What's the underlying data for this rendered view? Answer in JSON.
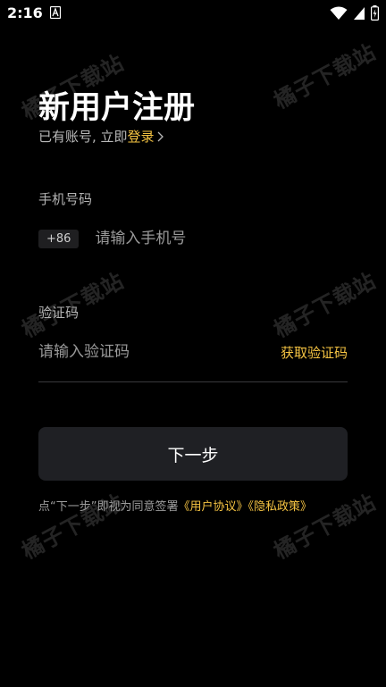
{
  "status_bar": {
    "time": "2:16",
    "icons": [
      "notification-a-icon",
      "wifi-icon",
      "cellular-signal-icon",
      "battery-charging-icon"
    ]
  },
  "watermark": {
    "text": "橘子下载站"
  },
  "header": {
    "title": "新用户注册",
    "subtitle_prefix": "已有账号, 立即",
    "login_link": "登录"
  },
  "phone_field": {
    "label": "手机号码",
    "country_code": "+86",
    "placeholder": "请输入手机号",
    "value": ""
  },
  "code_field": {
    "label": "验证码",
    "placeholder": "请输入验证码",
    "value": "",
    "get_code_label": "获取验证码"
  },
  "next_button": {
    "label": "下一步"
  },
  "agreement": {
    "prefix": "点“下一步”即视为同意签署",
    "user_agreement": "《用户协议》",
    "privacy_policy": "《隐私政策》"
  },
  "colors": {
    "accent": "#f5c342",
    "background": "#000000",
    "button_bg": "#1f2024"
  }
}
